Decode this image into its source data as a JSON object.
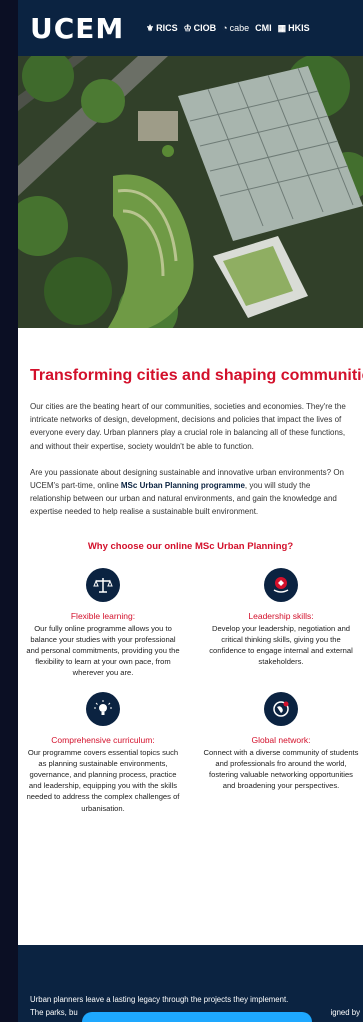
{
  "header": {
    "logo": "UCEM",
    "partners": [
      {
        "name": "RICS",
        "icon": "rics-crest-icon"
      },
      {
        "name": "CIOB",
        "icon": "ciob-crest-icon"
      },
      {
        "name": "cabe",
        "icon": "cabe-mark-icon"
      },
      {
        "name": "CMI",
        "icon": "cmi-mark-icon"
      },
      {
        "name": "HKIS",
        "icon": "hkis-mark-icon"
      }
    ]
  },
  "hero": {
    "icon": "aerial-city-green-roofs-image"
  },
  "main": {
    "headline": "Transforming cities and shaping communities",
    "para1": "Our cities are the beating heart of our communities, societies and economies. They're the intricate networks of design, development, decisions and policies that impact the lives of everyone every day. Urban planners play a crucial role in balancing all of these functions, and without their expertise, society wouldn't be able to function.",
    "para2_a": "Are you passionate about designing sustainable and innovative urban environments? On UCEM's part-time, online ",
    "para2_highlight": "MSc Urban Planning programme",
    "para2_b": ", you will study the relationship between our urban and natural environments, and gain the knowledge and expertise needed to help realise a sustainable built environment.",
    "why_title": "Why choose our online MSc Urban Planning?"
  },
  "features": [
    {
      "icon": "scales-icon",
      "title": "Flexible learning:",
      "text": "Our fully online programme allows you to balance your studies with your professional and personal commitments, providing you the flexibility to learn at your own pace, from wherever you are."
    },
    {
      "icon": "leadership-badge-icon",
      "title": "Leadership skills:",
      "text": "Develop your leadership, negotiation and critical thinking skills, giving you the confidence to engage internal and external stakeholders."
    },
    {
      "icon": "lightbulb-icon",
      "title": "Comprehensive curriculum:",
      "text": "Our programme covers essential topics such as planning sustainable environments, governance, and planning process, practice and leadership, equipping you with the skills needed to address the complex challenges of urbanisation."
    },
    {
      "icon": "globe-network-icon",
      "title": "Global network:",
      "text": "Connect with a diverse community of students and professionals fro around the world, fostering valuable networking opportunities and broadening your perspectives."
    }
  ],
  "footer": {
    "text_line1": "Urban planners leave a lasting legacy through the projects they implement.",
    "text_line2_start": "The parks, bu",
    "text_line2_end": "igned by"
  },
  "colors": {
    "navy": "#0b2341",
    "red": "#d3102b",
    "cta": "#1ea8ff"
  }
}
